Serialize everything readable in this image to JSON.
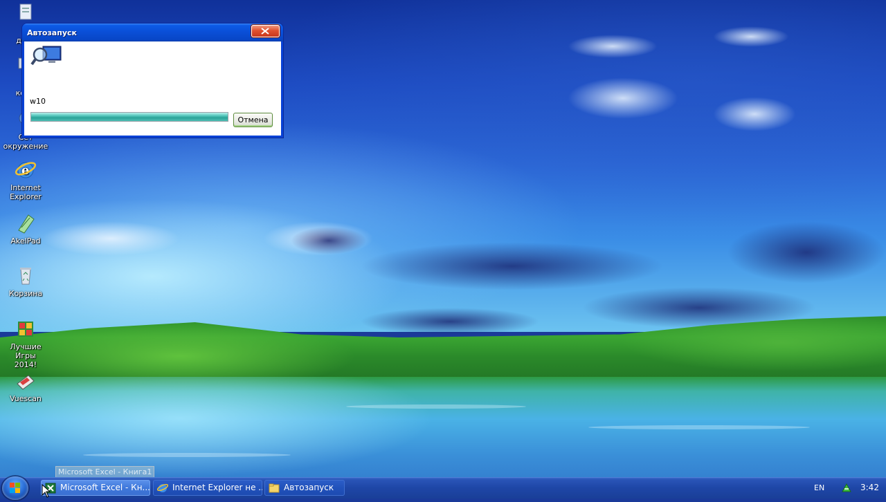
{
  "desktop": {
    "icons": [
      {
        "label_line1": "М",
        "label_line2": "доку"
      },
      {
        "label_line1": "М",
        "label_line2": "комп"
      },
      {
        "label_line1": "Сет",
        "label_line2": "окружение"
      },
      {
        "label_line1": "Internet",
        "label_line2": "Explorer"
      },
      {
        "label_line1": "AkelPad",
        "label_line2": ""
      },
      {
        "label_line1": "Корзина",
        "label_line2": ""
      },
      {
        "label_line1": "Лучшие Игры",
        "label_line2": "2014!"
      },
      {
        "label_line1": "Vuescan",
        "label_line2": ""
      }
    ]
  },
  "dialog": {
    "title": "Автозапуск",
    "item_name": "w10",
    "progress": 1.0,
    "cancel_label": "Отмена",
    "icon": "search-computer-icon"
  },
  "tooltip": {
    "text": "Microsoft Excel - Книга1"
  },
  "taskbar": {
    "start_icon": "windows-logo-icon",
    "tasks": [
      {
        "label": "Microsoft Excel - Кн...",
        "icon": "excel-icon",
        "active": true
      },
      {
        "label": "Internet Explorer не ...",
        "icon": "ie-icon",
        "active": false
      },
      {
        "label": "Автозапуск",
        "icon": "folder-icon",
        "active": false
      }
    ],
    "tray": {
      "language": "EN",
      "network_icon": "network-icon",
      "clock": "3:42"
    }
  },
  "colors": {
    "title_blue": "#0a4fd8",
    "close_red": "#e0502e",
    "progress_teal": "#2aa398",
    "taskbar_blue": "#1e46a6"
  }
}
